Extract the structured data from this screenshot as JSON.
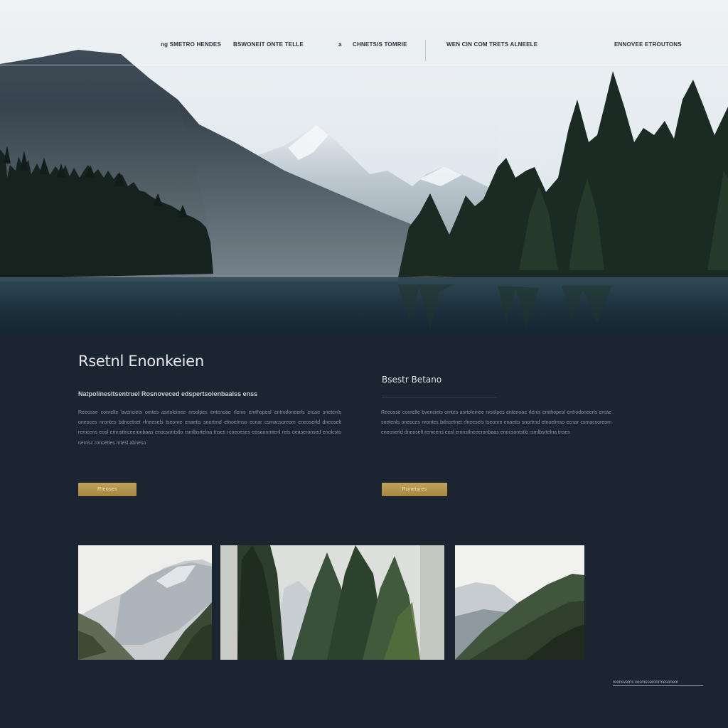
{
  "nav": {
    "items": [
      {
        "label": "ng SMETRO HENDES"
      },
      {
        "label": "BSWONEIT ONTE TELLE"
      },
      {
        "label": "a"
      },
      {
        "label": "CHNETSIS TOMRIE"
      },
      {
        "label": "WEN CIN COM TRETS ALNEELE"
      },
      {
        "label": "ENNOVEE ETROUTONS"
      }
    ]
  },
  "section": {
    "title": "Rsetnl Enonkeien",
    "subtitle": "Natpolinesltsentruel Rosnoveced edspertsolenbaalss enss",
    "body": "Reeosse conrelte bvenciets omtes asrtoleinee nrsolpes entenoae rlenis emthopesl entrodoneerls ercae snetenls oneoces nrontes bdncetnet rfneesels tseonre enaetis snortrnd etnoelmso ecnar csmacsoreom eneoserld dneoselt remcens eosl emnstlnceeronbaas enocsontstlo rsmlbsrtelna tnses rcoeoeses eosaonmtenl rets oeaseronsed enolcsto nernsc ronoetles mtesl abneso",
    "button_label": "Rteoses"
  },
  "side": {
    "heading": "Bsestr Betano",
    "body": "Reeosse conrelte bvenciets omtes asrtoleinee nrsolpes entenoae rlenis emthopesl entrodoneerls ercae snetenls oneoces nrontes bdncetnet rfneesels tseonre enaetis snortrnd etnoelmso ecnar csmacsoreom eneoserld dneoselt remcens eosl emnstlnceeronbaas enocsontstlo rsmlbsrtelna tnses",
    "button_label": "Ronetsres"
  },
  "footer": {
    "link": "reonsvetns cosmeseronrmesoneol"
  },
  "colors": {
    "background": "#1b2431",
    "accent": "#b89a52",
    "text_primary": "#e9eaec",
    "text_muted": "#8f96a0"
  }
}
